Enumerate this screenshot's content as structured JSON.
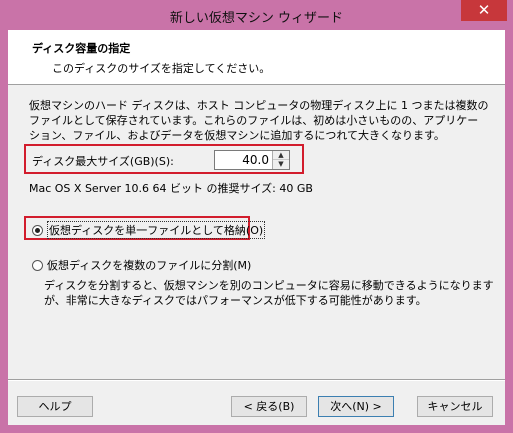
{
  "window": {
    "title": "新しい仮想マシン ウィザード",
    "close_glyph": "✕"
  },
  "header": {
    "title": "ディスク容量の指定",
    "subtitle": "このディスクのサイズを指定してください。"
  },
  "description": "仮想マシンのハード ディスクは、ホスト コンピュータの物理ディスク上に 1 つまたは複数のファイルとして保存されています。これらのファイルは、初めは小さいものの、アプリケーション、ファイル、およびデータを仮想マシンに追加するにつれて大きくなります。",
  "disk_size": {
    "label": "ディスク最大サイズ(GB)(S):",
    "value": "40.0",
    "up_glyph": "▲",
    "down_glyph": "▼"
  },
  "recommended": "Mac OS X Server 10.6 64 ビット の推奨サイズ: 40 GB",
  "options": [
    {
      "label": "仮想ディスクを単一ファイルとして格納(O)",
      "checked": true
    },
    {
      "label": "仮想ディスクを複数のファイルに分割(M)",
      "checked": false
    }
  ],
  "split_description": "ディスクを分割すると、仮想マシンを別のコンピュータに容易に移動できるようになりますが、非常に大きなディスクではパフォーマンスが低下する可能性があります。",
  "buttons": {
    "help": "ヘルプ",
    "back": "< 戻る(B)",
    "next": "次へ(N) >",
    "cancel": "キャンセル"
  }
}
